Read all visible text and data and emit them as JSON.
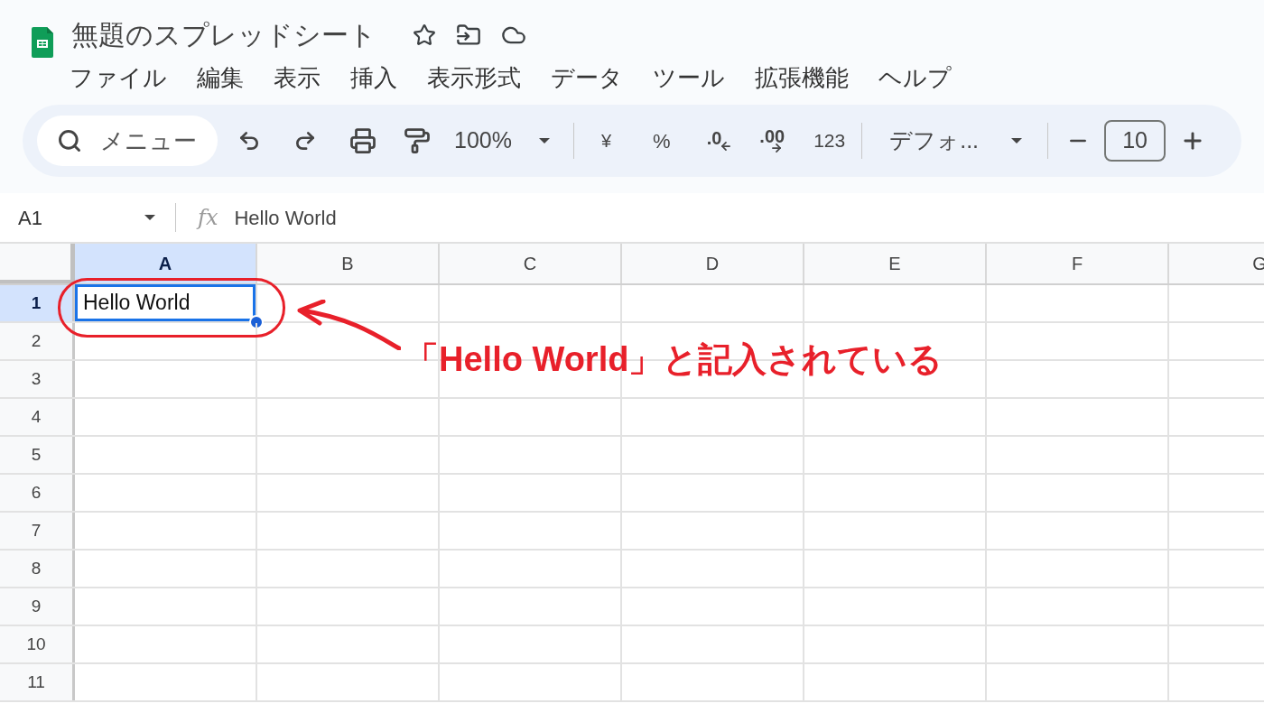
{
  "document": {
    "title": "無題のスプレッドシート"
  },
  "menu": [
    {
      "label": "ファイル"
    },
    {
      "label": "編集"
    },
    {
      "label": "表示"
    },
    {
      "label": "挿入"
    },
    {
      "label": "表示形式"
    },
    {
      "label": "データ"
    },
    {
      "label": "ツール"
    },
    {
      "label": "拡張機能"
    },
    {
      "label": "ヘルプ"
    }
  ],
  "toolbar": {
    "search_placeholder": "メニュー",
    "zoom": "100%",
    "currency": "¥",
    "percent": "%",
    "decrease_decimal": ".0",
    "increase_decimal": ".00",
    "number_format": "123",
    "font": "デフォ...",
    "font_size": "10"
  },
  "formula_bar": {
    "cell_ref": "A1",
    "fx": "fx",
    "value": "Hello World"
  },
  "sheet": {
    "columns": [
      {
        "label": "A",
        "selected": true
      },
      {
        "label": "B",
        "selected": false
      },
      {
        "label": "C",
        "selected": false
      },
      {
        "label": "D",
        "selected": false
      },
      {
        "label": "E",
        "selected": false
      },
      {
        "label": "F",
        "selected": false
      },
      {
        "label": "G",
        "selected": false
      }
    ],
    "rows": [
      {
        "label": "1",
        "selected": true,
        "cells": [
          {
            "value": "Hello World",
            "selected": true
          }
        ]
      },
      {
        "label": "2",
        "selected": false
      },
      {
        "label": "3",
        "selected": false
      },
      {
        "label": "4",
        "selected": false
      },
      {
        "label": "5",
        "selected": false
      },
      {
        "label": "6",
        "selected": false
      },
      {
        "label": "7",
        "selected": false
      },
      {
        "label": "8",
        "selected": false
      },
      {
        "label": "9",
        "selected": false
      },
      {
        "label": "10",
        "selected": false
      },
      {
        "label": "11",
        "selected": false
      }
    ]
  },
  "annotation": {
    "text": "「Hello World」と記入されている"
  }
}
